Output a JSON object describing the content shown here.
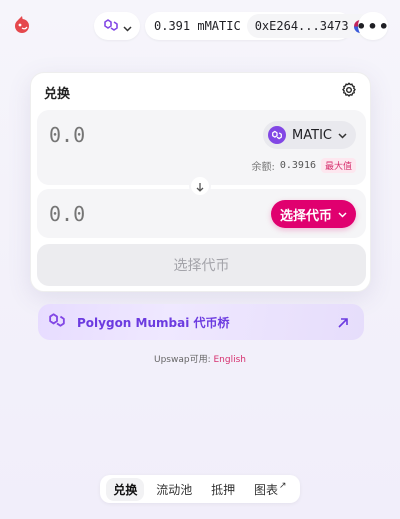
{
  "colors": {
    "accent": "#e0006f",
    "polygon": "#8247e5",
    "bridge_text": "#6c3be0"
  },
  "header": {
    "logo_icon": "unicorn-logo-icon",
    "network_icon": "polygon-icon",
    "wallet_balance": "0.391 mMATIC",
    "wallet_address": "0xE264...3473",
    "more_label": "•••"
  },
  "swap": {
    "title": "兑换",
    "settings_icon": "gear-icon",
    "input": {
      "amount_placeholder": "0.0",
      "token": "MATIC",
      "balance_label": "余额:",
      "balance_value": "0.3916",
      "max_label": "最大值"
    },
    "output": {
      "amount_placeholder": "0.0",
      "select_label": "选择代币"
    },
    "submit_label": "选择代币"
  },
  "bridge": {
    "label": "Polygon Mumbai 代币桥"
  },
  "availability": {
    "prefix": "Upswap可用:",
    "language": "English"
  },
  "nav": {
    "items": [
      {
        "label": "兑换",
        "active": true
      },
      {
        "label": "流动池",
        "active": false
      },
      {
        "label": "抵押",
        "active": false
      },
      {
        "label": "图表",
        "active": false,
        "external": "↗"
      }
    ]
  }
}
